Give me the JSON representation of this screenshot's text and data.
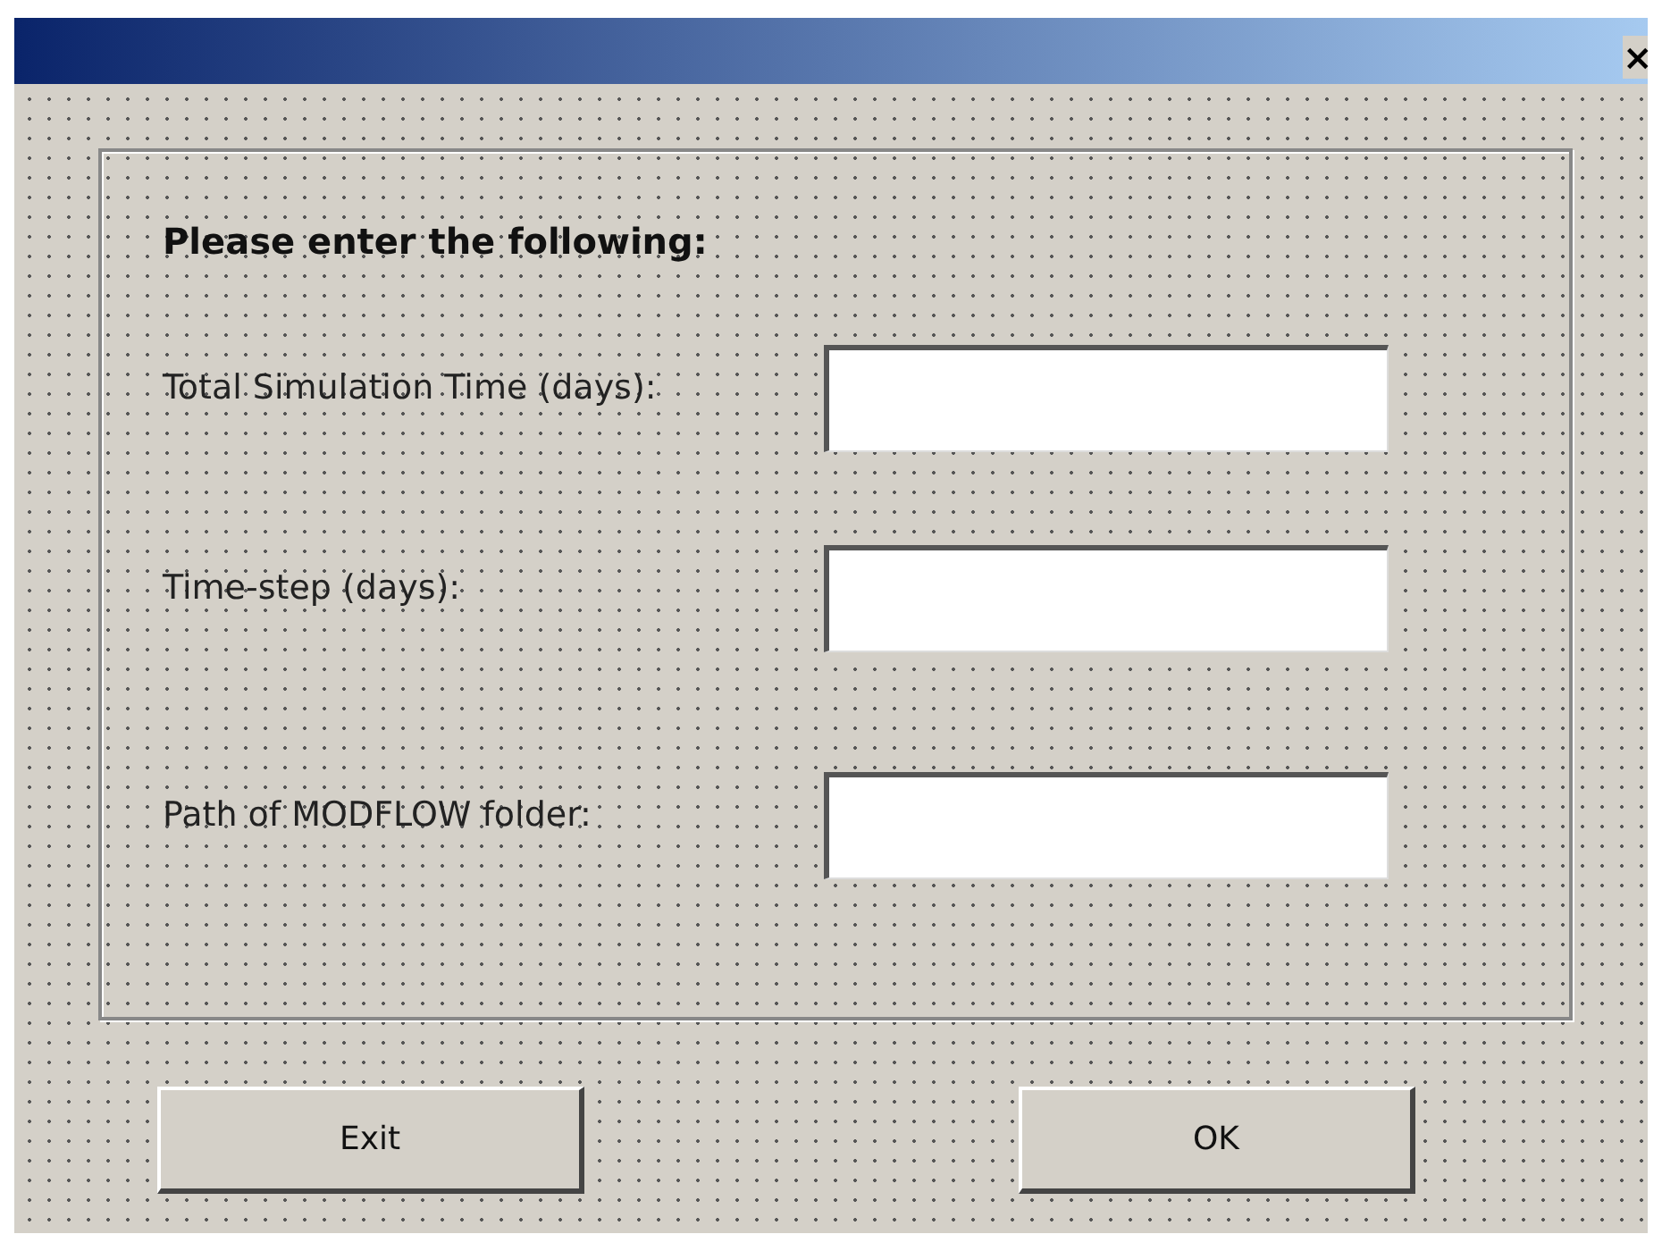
{
  "window": {
    "close": "×"
  },
  "frame": {
    "heading": "Please enter the following:",
    "fields": [
      {
        "label": "Total Simulation Time (days):"
      },
      {
        "label": "Time-step (days):"
      },
      {
        "label": "Path of MODFLOW folder:"
      }
    ]
  },
  "buttons": [
    {
      "label": "Exit"
    },
    {
      "label": "OK"
    }
  ]
}
